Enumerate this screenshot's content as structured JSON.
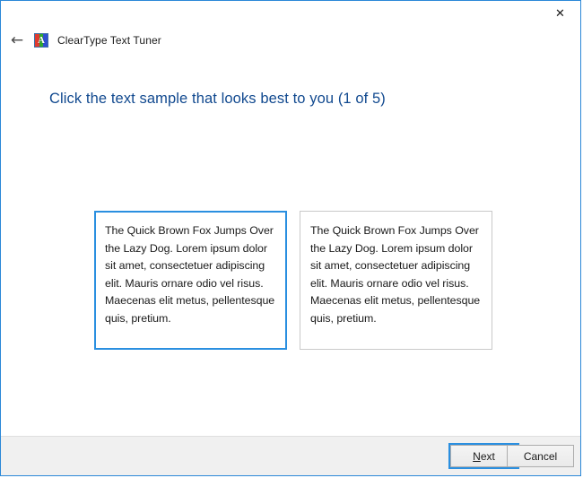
{
  "window": {
    "app_title": "ClearType Text Tuner",
    "app_icon": "cleartype-icon",
    "icon_letter": "A",
    "close_label": "✕",
    "back_label": "←",
    "border_color": "#2b88d8"
  },
  "main": {
    "heading": "Click the text sample that looks best to you (1 of 5)",
    "heading_color": "#11498f",
    "step_current": 1,
    "step_total": 5
  },
  "samples": [
    {
      "id": "sample-1",
      "selected": true,
      "border_color": "#2a8fe0",
      "text": "The Quick Brown Fox Jumps Over the Lazy Dog. Lorem ipsum dolor sit amet, consectetuer adipiscing elit. Mauris ornare odio vel risus. Maecenas elit metus, pellentesque quis, pretium."
    },
    {
      "id": "sample-2",
      "selected": false,
      "border_color": "#c9c9c9",
      "text": "The Quick Brown Fox Jumps Over the Lazy Dog. Lorem ipsum dolor sit amet, consectetuer adipiscing elit. Mauris ornare odio vel risus. Maecenas elit metus, pellentesque quis, pretium."
    }
  ],
  "footer": {
    "next_accel": "N",
    "next_rest": "ext",
    "cancel_label": "Cancel",
    "focus_color": "#2a8fe0"
  }
}
